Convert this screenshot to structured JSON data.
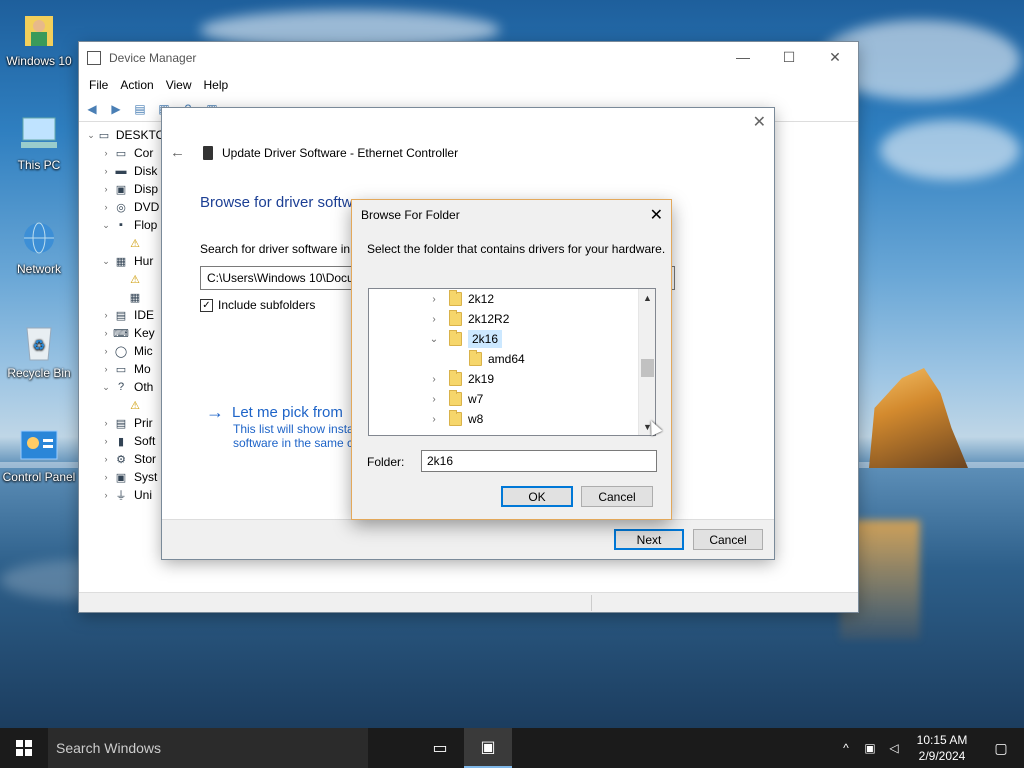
{
  "desktop": {
    "icons": [
      {
        "label": "Windows 10",
        "icon": "user-folder-icon"
      },
      {
        "label": "This PC",
        "icon": "computer-icon"
      },
      {
        "label": "Network",
        "icon": "network-globe-icon"
      },
      {
        "label": "Recycle Bin",
        "icon": "recycle-bin-icon"
      },
      {
        "label": "Control Panel",
        "icon": "control-panel-icon"
      }
    ]
  },
  "device_manager": {
    "title": "Device Manager",
    "menu": [
      "File",
      "Action",
      "View",
      "Help"
    ],
    "tree": [
      {
        "label": "DESKTO",
        "expanded": true,
        "level": 0
      },
      {
        "label": "Cor",
        "level": 1
      },
      {
        "label": "Disk",
        "level": 1
      },
      {
        "label": "Disp",
        "level": 1
      },
      {
        "label": "DVD",
        "level": 1
      },
      {
        "label": "Flop",
        "level": 1,
        "expanded": true
      },
      {
        "label": "",
        "level": 2
      },
      {
        "label": "Hur",
        "level": 1,
        "expanded": true
      },
      {
        "label": "",
        "level": 2
      },
      {
        "label": "",
        "level": 2
      },
      {
        "label": "IDE",
        "level": 1
      },
      {
        "label": "Key",
        "level": 1
      },
      {
        "label": "Mic",
        "level": 1
      },
      {
        "label": "Mo",
        "level": 1
      },
      {
        "label": "Oth",
        "level": 1,
        "expanded": true
      },
      {
        "label": "",
        "level": 2
      },
      {
        "label": "Prir",
        "level": 1
      },
      {
        "label": "Soft",
        "level": 1
      },
      {
        "label": "Stor",
        "level": 1
      },
      {
        "label": "Syst",
        "level": 1
      },
      {
        "label": "Uni",
        "level": 1
      }
    ]
  },
  "wizard": {
    "header": "Update Driver Software - Ethernet Controller",
    "heading": "Browse for driver softw",
    "search_label": "Search for driver software in t",
    "path_value": "C:\\Users\\Windows 10\\Docu",
    "include_subfolders": "Include subfolders",
    "pick_link": "Let me pick from",
    "pick_desc_1": "This list will show insta",
    "pick_desc_2": "software in the same c",
    "next": "Next",
    "cancel": "Cancel"
  },
  "browse_dialog": {
    "title": "Browse For Folder",
    "description": "Select the folder that contains drivers for your hardware.",
    "folders": [
      {
        "name": "2k12",
        "level": 0,
        "state": "collapsed"
      },
      {
        "name": "2k12R2",
        "level": 0,
        "state": "collapsed"
      },
      {
        "name": "2k16",
        "level": 0,
        "state": "expanded",
        "selected": true
      },
      {
        "name": "amd64",
        "level": 1,
        "state": "none"
      },
      {
        "name": "2k19",
        "level": 0,
        "state": "collapsed"
      },
      {
        "name": "w7",
        "level": 0,
        "state": "collapsed"
      },
      {
        "name": "w8",
        "level": 0,
        "state": "collapsed"
      }
    ],
    "folder_label": "Folder:",
    "folder_value": "2k16",
    "ok": "OK",
    "cancel": "Cancel"
  },
  "taskbar": {
    "search_placeholder": "Search Windows",
    "time": "10:15 AM",
    "date": "2/9/2024"
  }
}
